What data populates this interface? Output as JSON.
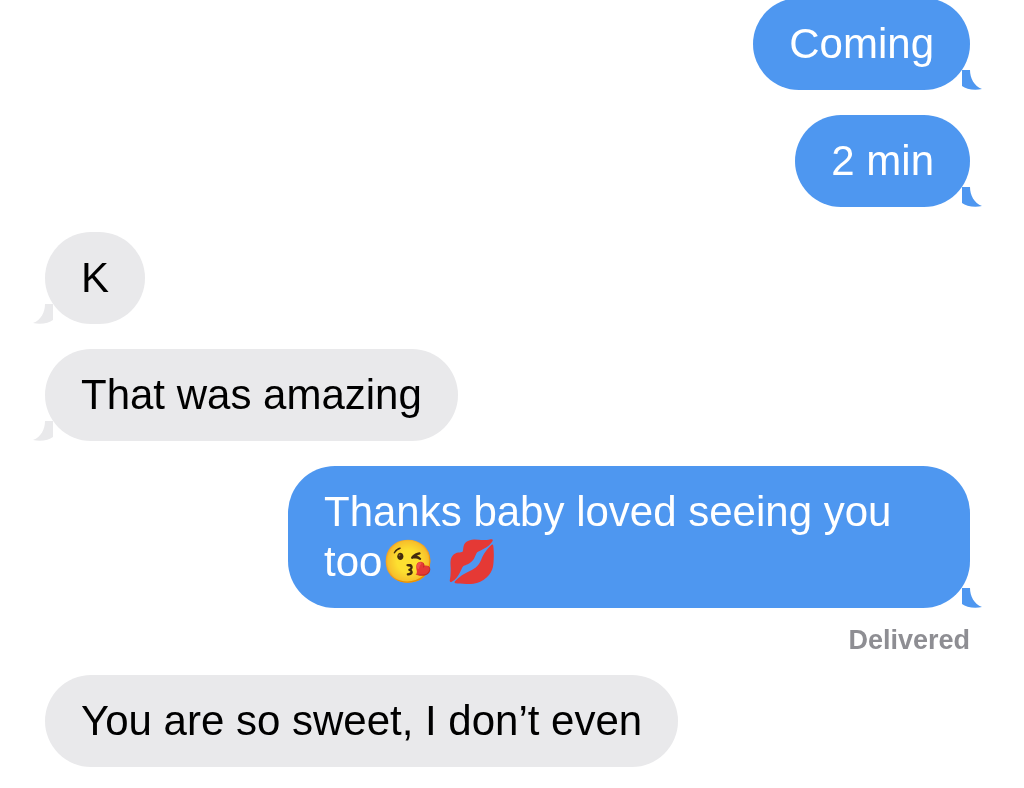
{
  "messages": [
    {
      "kind": "sent",
      "text": "Coming",
      "tail": true
    },
    {
      "kind": "sent",
      "text": "2 min",
      "tail": true
    },
    {
      "kind": "received",
      "text": "K",
      "tail": true
    },
    {
      "kind": "received",
      "text": "That was amazing",
      "tail": true
    },
    {
      "kind": "sent",
      "text": "Thanks baby loved seeing you too😘 💋",
      "tail": true,
      "status": "Delivered"
    },
    {
      "kind": "received",
      "text": "You are so sweet, I don’t even",
      "tail": false
    }
  ]
}
